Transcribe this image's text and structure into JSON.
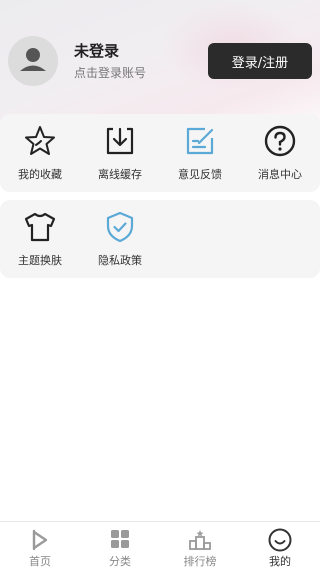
{
  "profile": {
    "name": "未登录",
    "subtitle": "点击登录账号",
    "login_button": "登录/注册"
  },
  "menu_row1": [
    {
      "label": "我的收藏",
      "icon": "star-icon"
    },
    {
      "label": "离线缓存",
      "icon": "download-icon"
    },
    {
      "label": "意见反馈",
      "icon": "feedback-edit-icon"
    },
    {
      "label": "消息中心",
      "icon": "question-icon"
    }
  ],
  "menu_row2": [
    {
      "label": "主题换肤",
      "icon": "tshirt-icon"
    },
    {
      "label": "隐私政策",
      "icon": "shield-check-icon"
    }
  ],
  "tabbar": [
    {
      "label": "首页",
      "icon": "play-home-icon"
    },
    {
      "label": "分类",
      "icon": "grid-icon"
    },
    {
      "label": "排行榜",
      "icon": "podium-icon"
    },
    {
      "label": "我的",
      "icon": "smile-icon",
      "active": true
    }
  ],
  "colors": {
    "accent_blue": "#5aa9d6",
    "dark_button": "#2b2b2b",
    "card_bg": "#f5f5f5"
  }
}
